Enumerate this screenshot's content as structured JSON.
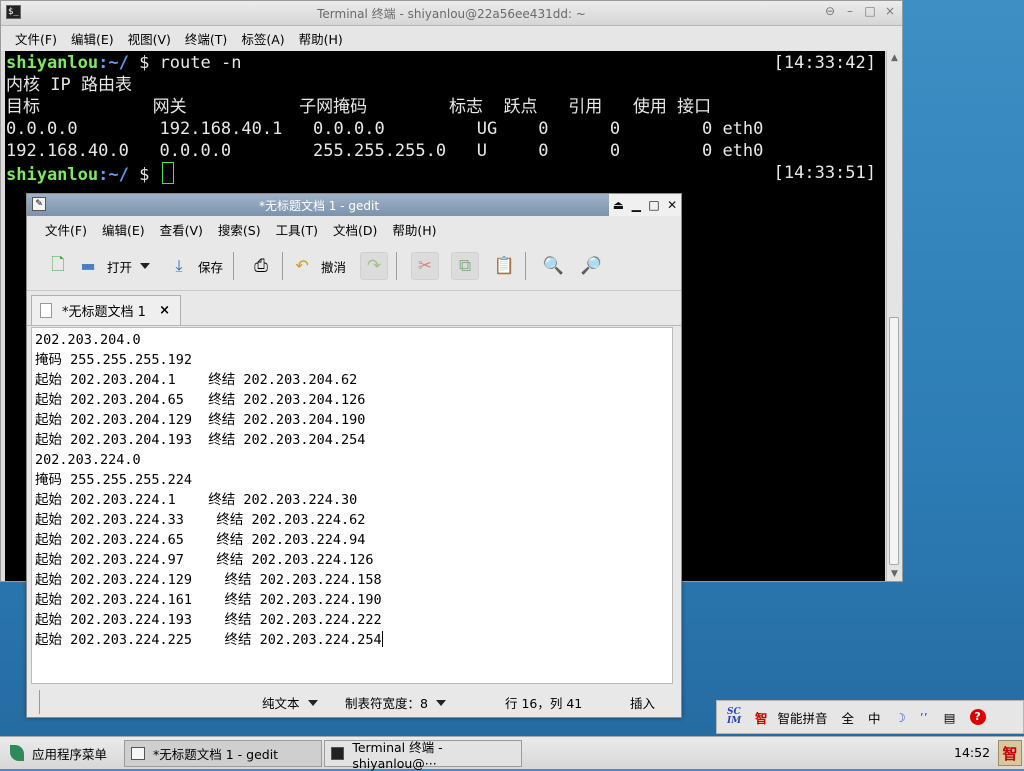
{
  "terminal": {
    "title": "Terminal 终端 - shiyanlou@22a56ee431dd: ~",
    "menu": [
      "文件(F)",
      "编辑(E)",
      "视图(V)",
      "终端(T)",
      "标签(A)",
      "帮助(H)"
    ],
    "prompt_user": "shiyanlou",
    "prompt_path": ":~/",
    "prompt_sign": " $",
    "command": " route -n",
    "time1": "[14:33:42]",
    "time2": "[14:33:51]",
    "route_title": "内核 IP 路由表",
    "header": "目标           网关           子网掩码        标志  跃点   引用   使用 接口",
    "rows": [
      "0.0.0.0        192.168.40.1   0.0.0.0         UG    0      0        0 eth0",
      "192.168.40.0   0.0.0.0        255.255.255.0   U     0      0        0 eth0"
    ]
  },
  "gedit": {
    "title": "*无标题文档 1 - gedit",
    "menu": [
      "文件(F)",
      "编辑(E)",
      "查看(V)",
      "搜索(S)",
      "工具(T)",
      "文档(D)",
      "帮助(H)"
    ],
    "toolbar": {
      "open": "打开",
      "save": "保存",
      "undo": "撤消"
    },
    "tab_label": "*无标题文档 1",
    "lines": [
      "202.203.204.0",
      "掩码 255.255.255.192",
      "起始 202.203.204.1    终结 202.203.204.62",
      "起始 202.203.204.65   终结 202.203.204.126",
      "起始 202.203.204.129  终结 202.203.204.190",
      "起始 202.203.204.193  终结 202.203.204.254",
      "202.203.224.0",
      "掩码 255.255.255.224",
      "起始 202.203.224.1    终结 202.203.224.30",
      "起始 202.203.224.33    终结 202.203.224.62",
      "起始 202.203.224.65    终结 202.203.224.94",
      "起始 202.203.224.97    终结 202.203.224.126",
      "起始 202.203.224.129    终结 202.203.224.158",
      "起始 202.203.224.161    终结 202.203.224.190",
      "起始 202.203.224.193    终结 202.203.224.222",
      "起始 202.203.224.225    终结 202.203.224.254"
    ],
    "status": {
      "syntax": "纯文本",
      "tab_width": "制表符宽度：8",
      "position": "行 16，列 41",
      "mode": "插入"
    }
  },
  "ime": {
    "logo": "SC IM",
    "zhi": "智",
    "name": "智能拼音",
    "full": "全",
    "zh": "中",
    "moon": "☽",
    "quote": "’’",
    "book": "▤",
    "help": "?"
  },
  "taskbar": {
    "start": "应用程序菜单",
    "task_gedit": "*无标题文档 1 - gedit",
    "task_terminal": "Terminal 终端 - shiyanlou@···",
    "clock": "14:52",
    "tray_zhi": "智"
  }
}
